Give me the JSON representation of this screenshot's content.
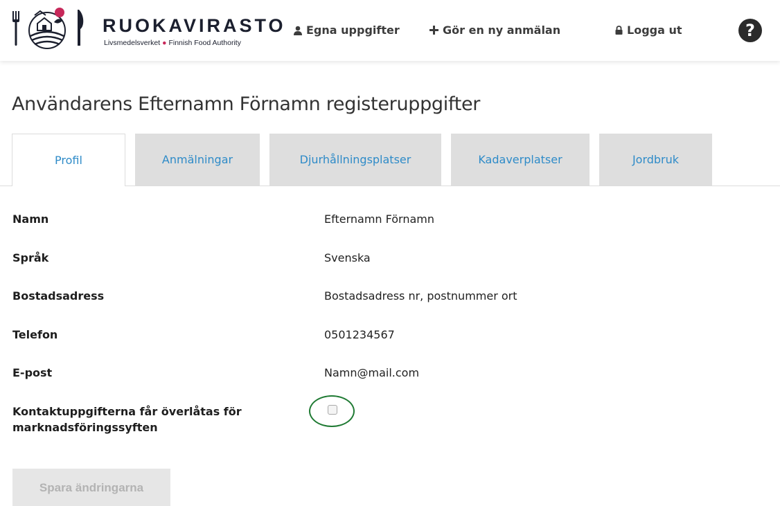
{
  "header": {
    "brand": "RUOKAVIRASTO",
    "brand_sub_left": "Livsmedelsverket",
    "brand_sub_right": "Finnish Food Authority",
    "nav": {
      "profile": "Egna uppgifter",
      "new_notification": "Gör en ny anmälan",
      "logout": "Logga ut"
    },
    "help_glyph": "?"
  },
  "page_title": "Användarens Efternamn Förnamn registeruppgifter",
  "tabs": [
    {
      "label": "Profil",
      "active": true
    },
    {
      "label": "Anmälningar",
      "active": false
    },
    {
      "label": "Djurhållningsplatser",
      "active": false
    },
    {
      "label": "Kadaverplatser",
      "active": false
    },
    {
      "label": "Jordbruk",
      "active": false
    }
  ],
  "fields": {
    "name": {
      "label": "Namn",
      "value": "Efternamn Förnamn"
    },
    "language": {
      "label": "Språk",
      "value": "Svenska"
    },
    "address": {
      "label": "Bostadsadress",
      "value": "Bostadsadress nr, postnummer ort"
    },
    "phone": {
      "label": "Telefon",
      "value": "0501234567"
    },
    "email": {
      "label": "E-post",
      "value": "Namn@mail.com"
    },
    "marketing": {
      "label_line1": "Kontaktuppgifterna får överlåtas för",
      "label_line2": "marknadsföringssyften",
      "checked": false
    }
  },
  "save_button": "Spara ändringarna",
  "icons": {
    "profile": "user-icon",
    "new_notification": "plus-icon",
    "logout": "lock-icon",
    "help": "question-icon"
  },
  "colors": {
    "tab_text": "#2e8bc8",
    "brand_dot": "#c7285a",
    "highlight_ring": "#1f7a33",
    "disabled_button": "#e6e6e6"
  }
}
